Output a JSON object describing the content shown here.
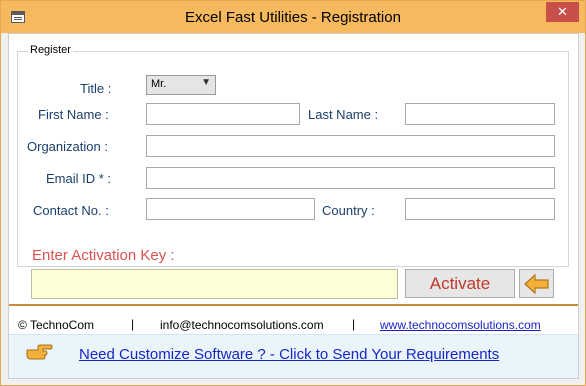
{
  "window": {
    "title": "Excel Fast Utilities - Registration",
    "close_glyph": "✕"
  },
  "group": {
    "legend": "Register"
  },
  "form": {
    "title_label": "Title :",
    "title_value": "Mr.",
    "first_name_label": "First Name :",
    "first_name_value": "",
    "last_name_label": "Last Name :",
    "last_name_value": "",
    "organization_label": "Organization :",
    "organization_value": "",
    "email_label": "Email ID * :",
    "email_value": "",
    "contact_label": "Contact No. :",
    "contact_value": "",
    "country_label": "Country :",
    "country_value": ""
  },
  "activation": {
    "label": "Enter Activation Key  :",
    "value": "",
    "activate_label": "Activate"
  },
  "footer": {
    "copyright": "© TechnoCom",
    "separator": "|",
    "email": "info@technocomsolutions.com",
    "website": "www.technocomsolutions.com"
  },
  "bottom": {
    "link": "Need Customize Software ? - Click to Send Your Requirements"
  },
  "icons": {
    "app": "app-icon",
    "close": "close-icon",
    "back": "back-arrow-icon",
    "hand": "pointing-hand-icon"
  },
  "colors": {
    "titlebar": "#f7b95d",
    "close": "#c7504a",
    "label": "#1b3f6b",
    "activation_label": "#d9534f",
    "activation_field": "#fefed6",
    "link": "#1a25c7"
  }
}
